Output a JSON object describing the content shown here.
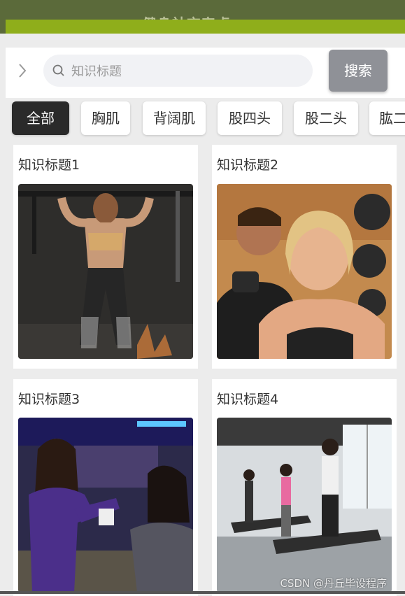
{
  "app_title": "健身社交安卓app",
  "search": {
    "placeholder": "知识标题",
    "button_label": "搜索"
  },
  "tabs": [
    {
      "label": "全部",
      "active": true
    },
    {
      "label": "胸肌",
      "active": false
    },
    {
      "label": "背阔肌",
      "active": false
    },
    {
      "label": "股四头",
      "active": false
    },
    {
      "label": "股二头",
      "active": false
    },
    {
      "label": "肱二",
      "active": false
    }
  ],
  "cards": [
    {
      "title": "知识标题1",
      "image": "woman-doing-pull-ups-photo"
    },
    {
      "title": "知识标题2",
      "image": "trainer-with-woman-dumbbells-photo"
    },
    {
      "title": "知识标题3",
      "image": "two-women-in-gym-photo"
    },
    {
      "title": "知识标题4",
      "image": "people-on-treadmills-photo"
    }
  ],
  "watermark": "CSDN @丹丘毕设程序",
  "colors": {
    "header": "#5b6a3a",
    "accent_green": "#8fae1b",
    "active_tab": "#2a2a2a",
    "search_button": "#8f9197"
  }
}
